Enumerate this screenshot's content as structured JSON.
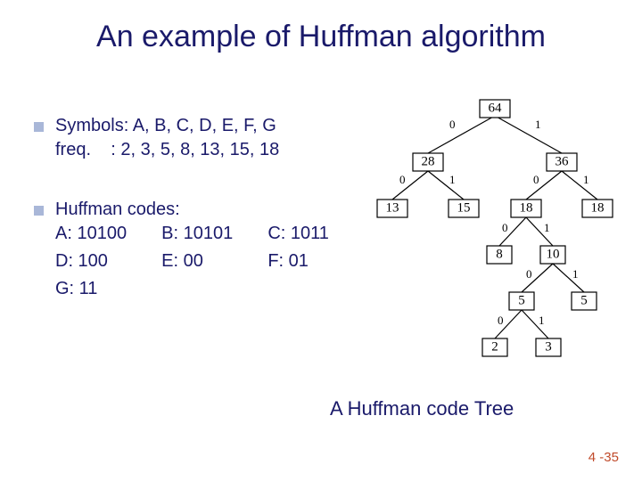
{
  "title": "An example of Huffman algorithm",
  "bullet1": {
    "line1": "Symbols: A, B, C, D, E, F, G",
    "line2": "freq.    : 2, 3, 5, 8, 13, 15, 18"
  },
  "bullet2": {
    "heading": "Huffman codes:",
    "codes": {
      "A": "A: 10100",
      "B": "B: 10101",
      "C": "C: 1011",
      "D": "D: 100",
      "E": "E: 00",
      "F": "F: 01",
      "G": "G: 11"
    }
  },
  "caption": "A Huffman code Tree",
  "pagenum": "4 -35",
  "tree": {
    "n64": "64",
    "n28": "28",
    "n36": "36",
    "n13": "13",
    "n15": "15",
    "n18a": "18",
    "n18b": "18",
    "n8": "8",
    "n10": "10",
    "n5a": "5",
    "n5b": "5",
    "n2": "2",
    "n3": "3",
    "edge": {
      "zero": "0",
      "one": "1"
    }
  },
  "chart_data": {
    "type": "tree",
    "title": "A Huffman code Tree",
    "symbols": [
      "A",
      "B",
      "C",
      "D",
      "E",
      "F",
      "G"
    ],
    "frequencies": [
      2,
      3,
      5,
      8,
      13,
      15,
      18
    ],
    "codes": {
      "A": "10100",
      "B": "10101",
      "C": "1011",
      "D": "100",
      "E": "00",
      "F": "01",
      "G": "11"
    },
    "nodes": [
      {
        "id": "n64",
        "value": 64,
        "children": [
          "n28",
          "n36"
        ],
        "edge_labels": [
          "0",
          "1"
        ]
      },
      {
        "id": "n28",
        "value": 28,
        "children": [
          "n13",
          "n15"
        ],
        "edge_labels": [
          "0",
          "1"
        ]
      },
      {
        "id": "n36",
        "value": 36,
        "children": [
          "n18a",
          "n18b"
        ],
        "edge_labels": [
          "0",
          "1"
        ]
      },
      {
        "id": "n13",
        "value": 13,
        "leaf": true,
        "symbol": "E"
      },
      {
        "id": "n15",
        "value": 15,
        "leaf": true,
        "symbol": "F"
      },
      {
        "id": "n18a",
        "value": 18,
        "children": [
          "n8",
          "n10"
        ],
        "edge_labels": [
          "0",
          "1"
        ]
      },
      {
        "id": "n18b",
        "value": 18,
        "leaf": true,
        "symbol": "G"
      },
      {
        "id": "n8",
        "value": 8,
        "leaf": true,
        "symbol": "D"
      },
      {
        "id": "n10",
        "value": 10,
        "children": [
          "n5a",
          "n5b"
        ],
        "edge_labels": [
          "0",
          "1"
        ]
      },
      {
        "id": "n5a",
        "value": 5,
        "children": [
          "n2",
          "n3"
        ],
        "edge_labels": [
          "0",
          "1"
        ]
      },
      {
        "id": "n5b",
        "value": 5,
        "leaf": true,
        "symbol": "C"
      },
      {
        "id": "n2",
        "value": 2,
        "leaf": true,
        "symbol": "A"
      },
      {
        "id": "n3",
        "value": 3,
        "leaf": true,
        "symbol": "B"
      }
    ]
  }
}
